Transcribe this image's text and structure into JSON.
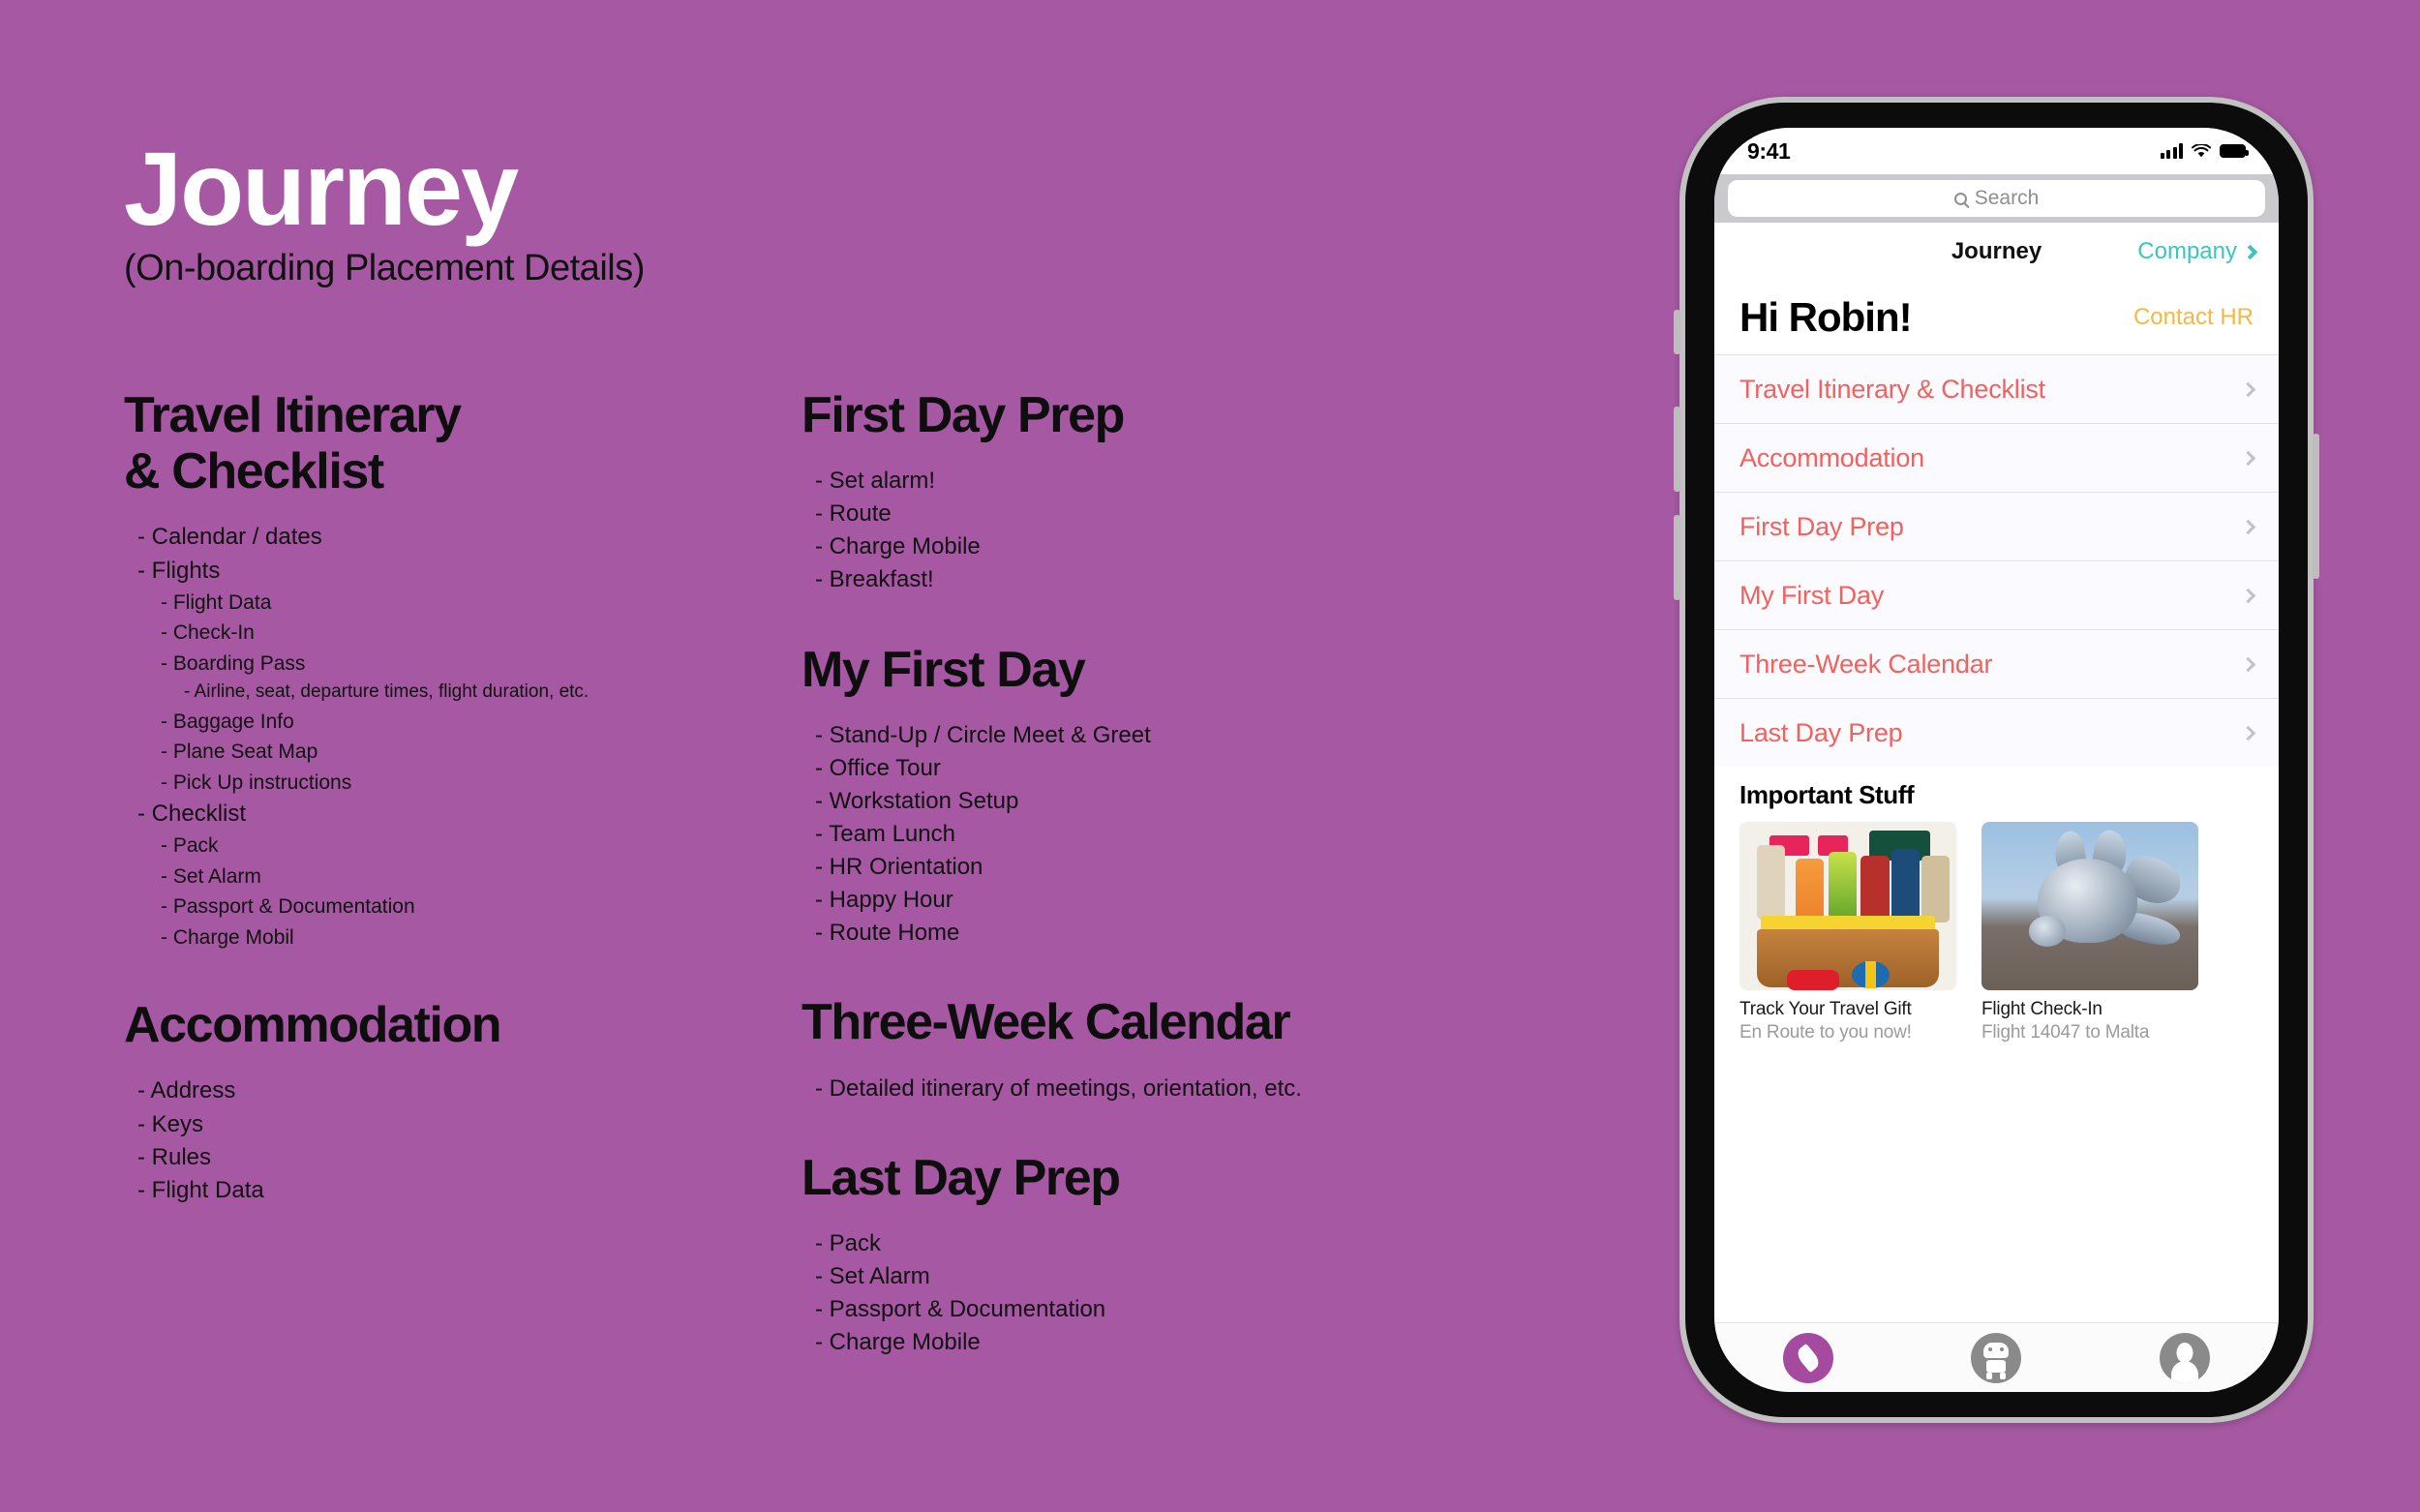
{
  "poster": {
    "title": "Journey",
    "subtitle": "(On-boarding Placement Details)",
    "background_color": "#a659a2",
    "left_column": [
      {
        "heading": "Travel Itinerary\n& Checklist",
        "heading_lines": [
          "Travel Itinerary",
          "& Checklist"
        ],
        "items": [
          {
            "level": 1,
            "text": "- Calendar / dates"
          },
          {
            "level": 1,
            "text": "- Flights"
          },
          {
            "level": 2,
            "text": "- Flight Data"
          },
          {
            "level": 2,
            "text": "- Check-In"
          },
          {
            "level": 2,
            "text": "- Boarding Pass"
          },
          {
            "level": 3,
            "text": "- Airline, seat, departure times, flight duration, etc."
          },
          {
            "level": 2,
            "text": "- Baggage Info"
          },
          {
            "level": 2,
            "text": "- Plane Seat Map"
          },
          {
            "level": 2,
            "text": "- Pick Up instructions"
          },
          {
            "level": 1,
            "text": "- Checklist"
          },
          {
            "level": 2,
            "text": "- Pack"
          },
          {
            "level": 2,
            "text": "- Set Alarm"
          },
          {
            "level": 2,
            "text": "- Passport & Documentation"
          },
          {
            "level": 2,
            "text": "- Charge Mobil"
          }
        ]
      },
      {
        "heading": "Accommodation",
        "heading_lines": [
          "Accommodation"
        ],
        "items": [
          {
            "level": 1,
            "text": "- Address"
          },
          {
            "level": 1,
            "text": "- Keys"
          },
          {
            "level": 1,
            "text": "- Rules"
          },
          {
            "level": 1,
            "text": "- Flight Data"
          }
        ]
      }
    ],
    "middle_column": [
      {
        "heading": "First Day Prep",
        "heading_lines": [
          "First Day Prep"
        ],
        "items": [
          {
            "level": 1,
            "text": "- Set alarm!"
          },
          {
            "level": 1,
            "text": "- Route"
          },
          {
            "level": 1,
            "text": "- Charge Mobile"
          },
          {
            "level": 1,
            "text": "- Breakfast!"
          }
        ]
      },
      {
        "heading": "My First Day",
        "heading_lines": [
          "My First Day"
        ],
        "items": [
          {
            "level": 1,
            "text": "- Stand-Up / Circle Meet & Greet"
          },
          {
            "level": 1,
            "text": "- Office Tour"
          },
          {
            "level": 1,
            "text": "- Workstation Setup"
          },
          {
            "level": 1,
            "text": "- Team Lunch"
          },
          {
            "level": 1,
            "text": "- HR Orientation"
          },
          {
            "level": 1,
            "text": "- Happy Hour"
          },
          {
            "level": 1,
            "text": "- Route Home"
          }
        ]
      },
      {
        "heading": "Three-Week Calendar",
        "heading_lines": [
          "Three-Week Calendar"
        ],
        "items": [
          {
            "level": 1,
            "text": "- Detailed itinerary of meetings, orientation, etc."
          }
        ]
      },
      {
        "heading": "Last Day Prep",
        "heading_lines": [
          "Last Day Prep"
        ],
        "items": [
          {
            "level": 1,
            "text": "- Pack"
          },
          {
            "level": 1,
            "text": "- Set Alarm"
          },
          {
            "level": 1,
            "text": "- Passport & Documentation"
          },
          {
            "level": 1,
            "text": "- Charge Mobile"
          }
        ]
      }
    ]
  },
  "phone": {
    "status_bar": {
      "time": "9:41",
      "cellular_icon": "signal-bars-icon",
      "wifi_icon": "wifi-icon",
      "battery_icon": "battery-icon"
    },
    "search": {
      "placeholder": "Search",
      "value": "",
      "icon": "search-icon"
    },
    "nav": {
      "title": "Journey",
      "right_label": "Company",
      "right_icon": "chevron-right-icon",
      "accent_color": "#3ac6bd"
    },
    "greeting": {
      "name": "Hi Robin!",
      "action": "Contact HR",
      "action_color": "#f5b841"
    },
    "list": {
      "row_color": "#f2615c",
      "rows": [
        {
          "label": "Travel Itinerary & Checklist",
          "icon": "chevron-right-icon"
        },
        {
          "label": "Accommodation",
          "icon": "chevron-right-icon"
        },
        {
          "label": "First Day Prep",
          "icon": "chevron-right-icon"
        },
        {
          "label": "My First Day",
          "icon": "chevron-right-icon"
        },
        {
          "label": "Three-Week Calendar",
          "icon": "chevron-right-icon"
        },
        {
          "label": "Last Day Prep",
          "icon": "chevron-right-icon"
        }
      ]
    },
    "important": {
      "heading": "Important Stuff",
      "cards": [
        {
          "image": "gift-basket-photo",
          "title": "Track Your Travel Gift",
          "subtitle": "En Route to you now!"
        },
        {
          "image": "chrome-plane-render",
          "title": "Flight Check-In",
          "subtitle": "Flight 14047 to Malta"
        }
      ]
    },
    "tabbar": {
      "tabs": [
        {
          "icon": "compass-icon",
          "active": true,
          "color": "#a44ba0"
        },
        {
          "icon": "robot-icon",
          "active": false,
          "color": "#8a8a8a"
        },
        {
          "icon": "profile-icon",
          "active": false,
          "color": "#8a8a8a"
        }
      ]
    }
  }
}
